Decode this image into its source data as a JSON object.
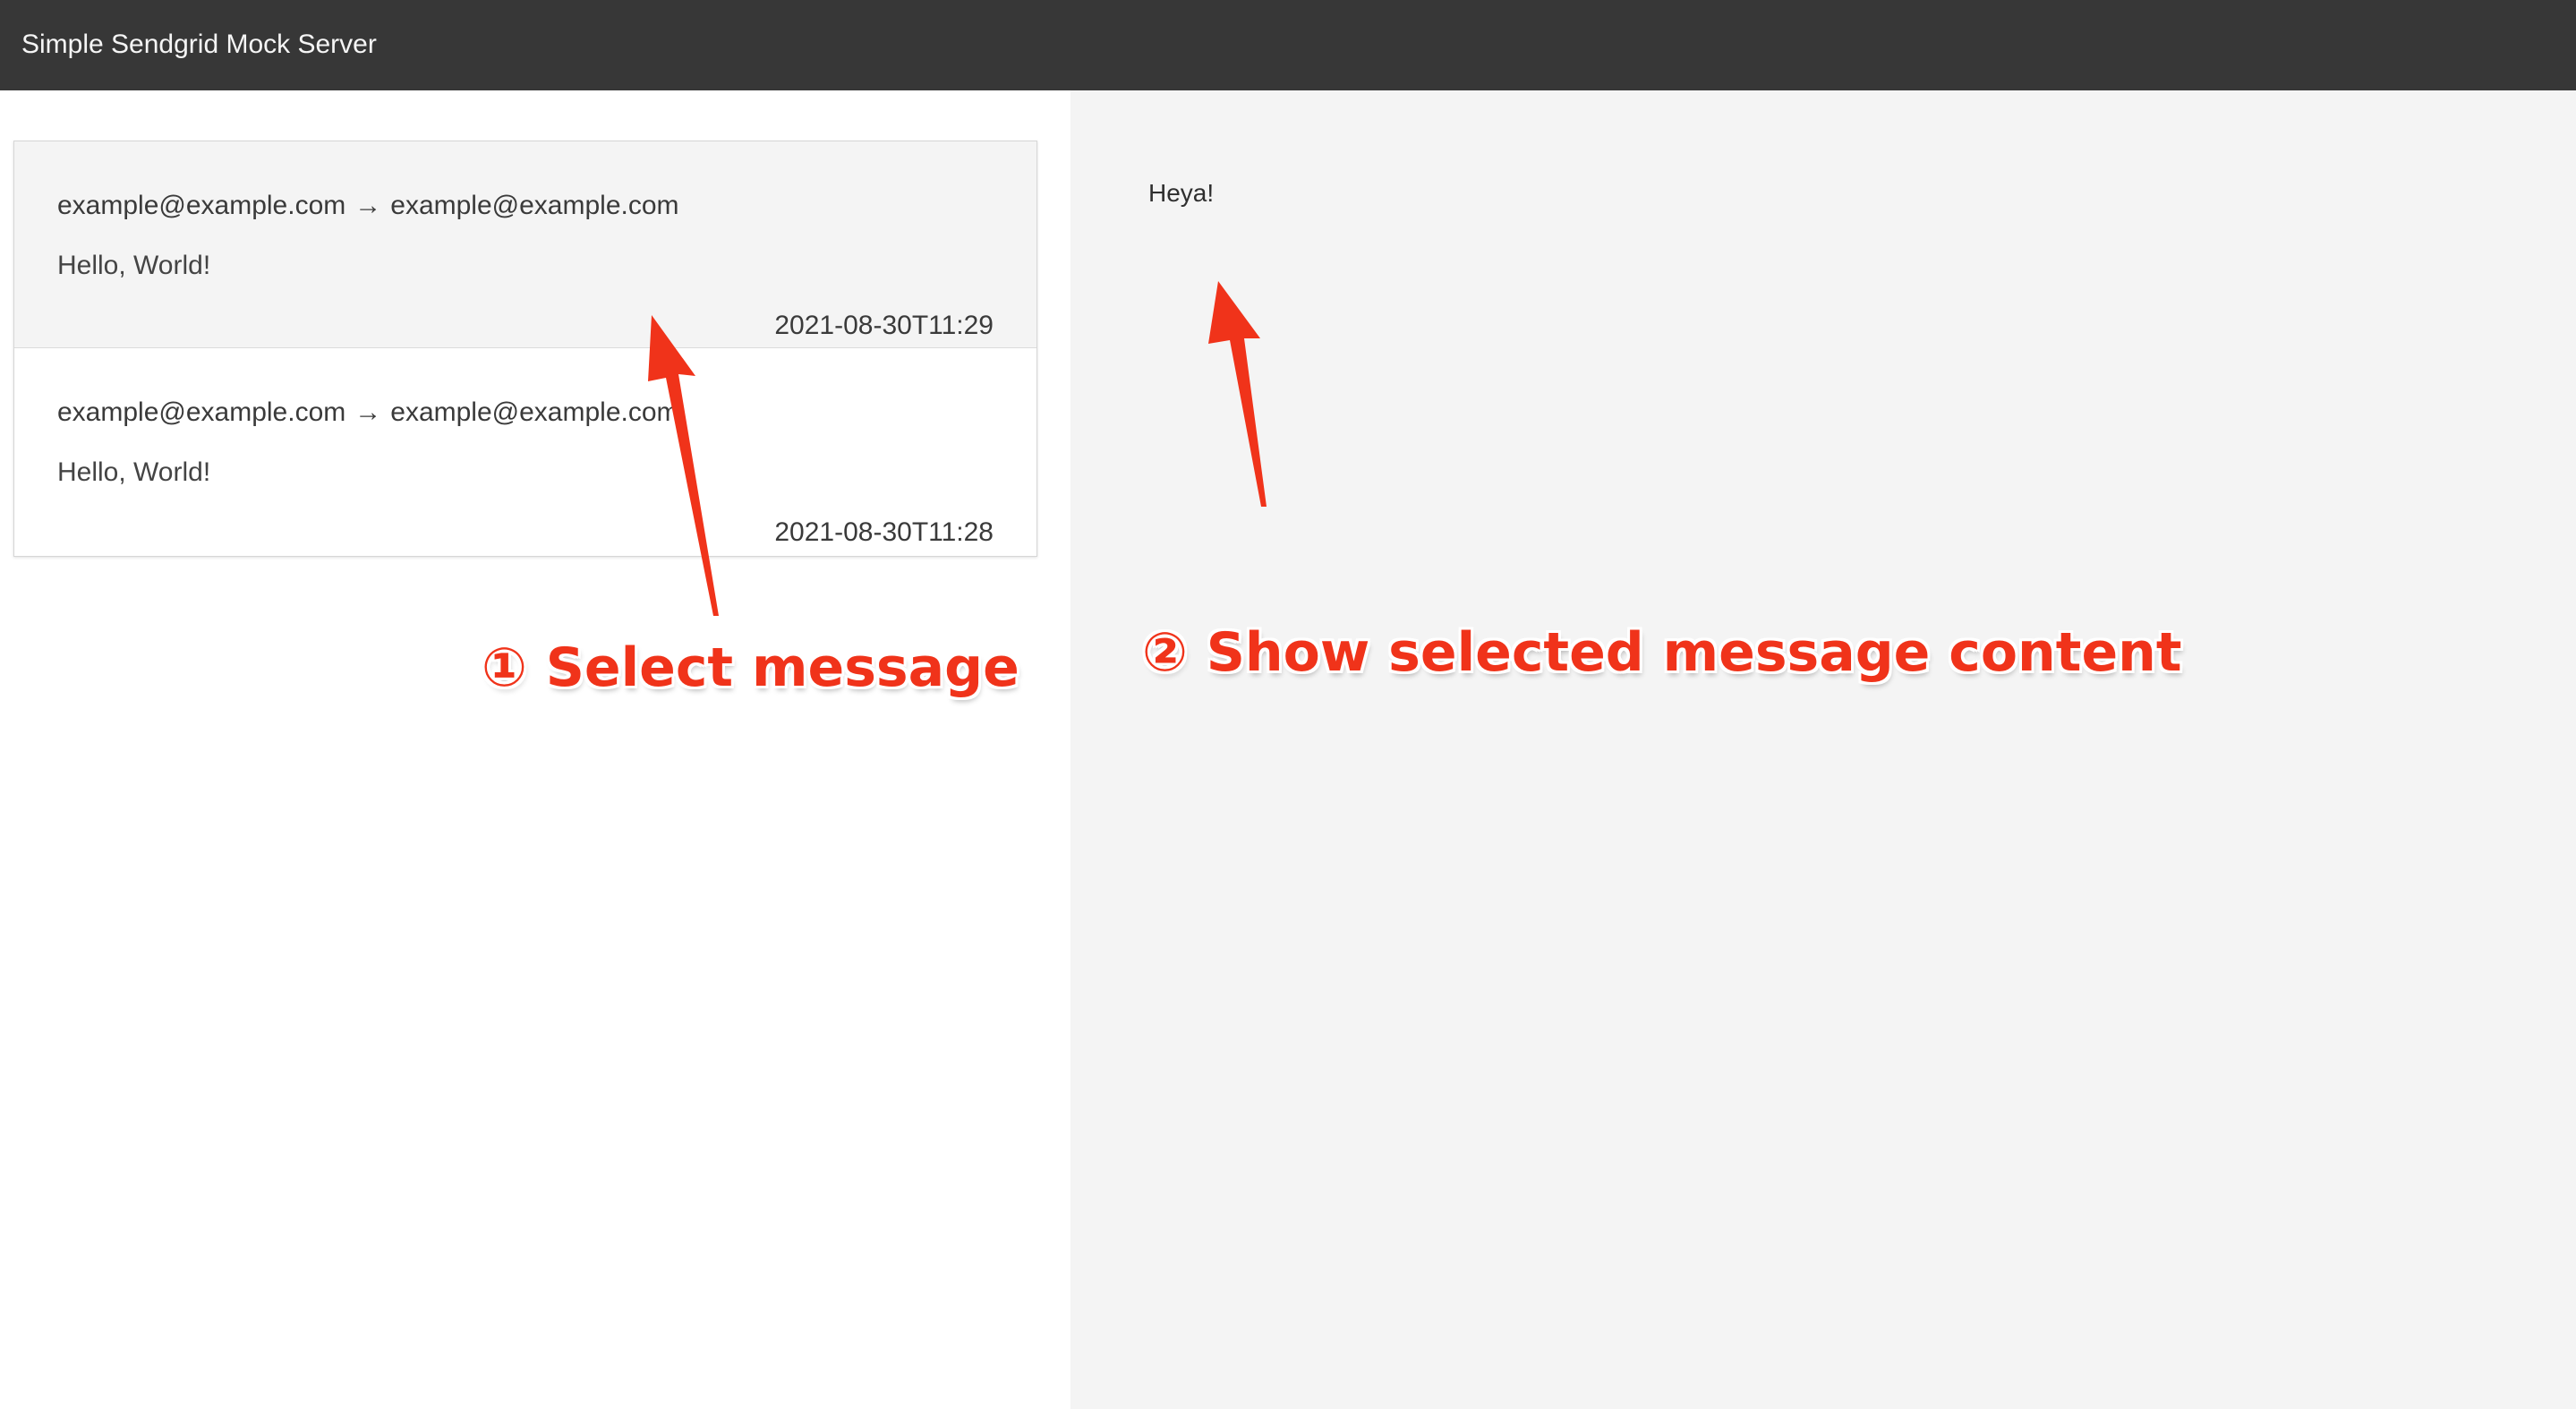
{
  "app": {
    "title": "Simple Sendgrid Mock Server"
  },
  "messages": [
    {
      "from": "example@example.com",
      "arrow": "→",
      "to": "example@example.com",
      "subject": "Hello, World!",
      "time": "2021-08-30T11:29",
      "selected": true
    },
    {
      "from": "example@example.com",
      "arrow": "→",
      "to": "example@example.com",
      "subject": "Hello, World!",
      "time": "2021-08-30T11:28",
      "selected": false
    }
  ],
  "preview": {
    "body": "Heya!"
  },
  "annotations": {
    "step1": "① Select message",
    "step2": "② Show selected message content",
    "color": "#f0331a"
  },
  "colors": {
    "topbar": "#373737",
    "preview_background": "#f4f4f4",
    "selected_item": "#f4f4f4"
  }
}
